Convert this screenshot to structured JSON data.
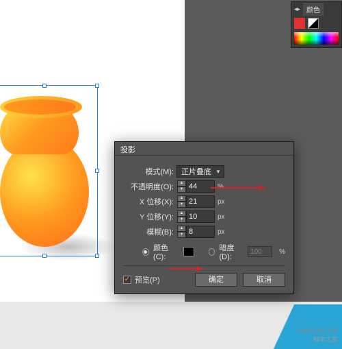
{
  "panel": {
    "tab_label": "颜色",
    "menu_icon": "menu-icon"
  },
  "dialog": {
    "title": "投影",
    "mode": {
      "label": "模式(M):",
      "value": "正片叠底"
    },
    "opacity": {
      "label": "不透明度(O):",
      "value": "44",
      "unit": "%"
    },
    "xoffset": {
      "label": "X 位移(X):",
      "value": "21",
      "unit": "px"
    },
    "yoffset": {
      "label": "Y 位移(Y):",
      "value": "10",
      "unit": "px"
    },
    "blur": {
      "label": "模糊(B):",
      "value": "8",
      "unit": "px"
    },
    "color_radio": {
      "label": "颜色(C):"
    },
    "darkness_radio": {
      "label": "暗度(D):",
      "value": "100",
      "unit": "%"
    },
    "preview_label": "预览(P)",
    "ok": "确定",
    "cancel": "取消"
  },
  "watermark": {
    "line1": "www.jb51.net",
    "line2": "脚本之家"
  }
}
